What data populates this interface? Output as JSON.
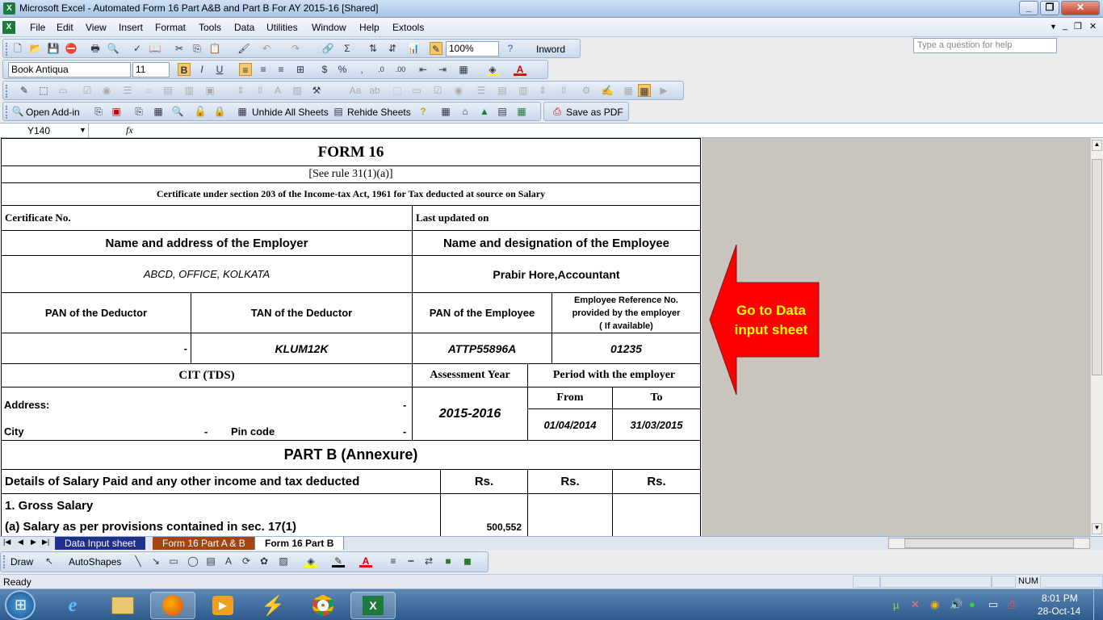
{
  "window": {
    "title": "Microsoft Excel - Automated Form 16 Part A&B and Part B For AY 2015-16  [Shared]"
  },
  "menu": {
    "items": [
      "File",
      "Edit",
      "View",
      "Insert",
      "Format",
      "Tools",
      "Data",
      "Utilities",
      "Window",
      "Help",
      "Extools"
    ],
    "help_placeholder": "Type a question for help"
  },
  "toolbar": {
    "zoom": "100%",
    "inword": "Inword",
    "font": "Book Antiqua",
    "size": "11"
  },
  "addins": {
    "open_addin": "Open Add-in",
    "unhide": "Unhide All Sheets",
    "rehide": "Rehide Sheets",
    "save_pdf": "Save as PDF"
  },
  "formula": {
    "name_box": "Y140",
    "fx": "fx",
    "value": ""
  },
  "form": {
    "title": "FORM 16",
    "rule": "[See rule 31(1)(a)]",
    "certificate_line": "Certificate under section 203 of the Income-tax Act, 1961 for Tax deducted at source on Salary",
    "certificate_no": "Certificate No.",
    "last_updated": "Last updated on",
    "employer_heading": "Name and address of the Employer",
    "employee_heading": "Name and designation of the Employee",
    "employer_value": "ABCD, OFFICE, KOLKATA",
    "employee_value": "Prabir Hore,Accountant",
    "pan_deductor": "PAN of the Deductor",
    "tan_deductor": "TAN of the Deductor",
    "pan_employee": "PAN of the Employee",
    "emp_ref_1": "Employee Reference No.",
    "emp_ref_2": "provided by the employer",
    "emp_ref_3": "( If available)",
    "pan_deductor_val": "-",
    "tan_val": "KLUM12K",
    "pan_emp_val": "ATTP55896A",
    "emp_ref_val": "01235",
    "cit": "CIT (TDS)",
    "assessment_year": "Assessment Year",
    "period": "Period with the employer",
    "from": "From",
    "to": "To",
    "address": "Address:",
    "address_val": "-",
    "city": "City",
    "city_val": "-",
    "pin": "Pin code",
    "pin_val": "-",
    "ay_val": "2015-2016",
    "from_val": "01/04/2014",
    "to_val": "31/03/2015",
    "part_b": "PART B (Annexure)",
    "details": "Details of Salary Paid and any other income and tax deducted",
    "rs": "Rs.",
    "gross": "1.  Gross Salary",
    "salary_a": "(a) Salary as per provisions contained in sec. 17(1)",
    "salary_a_val": "500,552"
  },
  "callout": {
    "text": "Go to Data input sheet",
    "color": "#ff0000",
    "text_color": "#ffff00"
  },
  "sheets": {
    "tab1": "Data Input sheet",
    "tab2": "Form 16 Part A & B",
    "tab3": "Form 16 Part B"
  },
  "drawbar": {
    "draw": "Draw",
    "autoshapes": "AutoShapes"
  },
  "status": {
    "left": "Ready",
    "num": "NUM"
  },
  "clock": {
    "time": "8:01 PM",
    "date": "28-Oct-14"
  }
}
